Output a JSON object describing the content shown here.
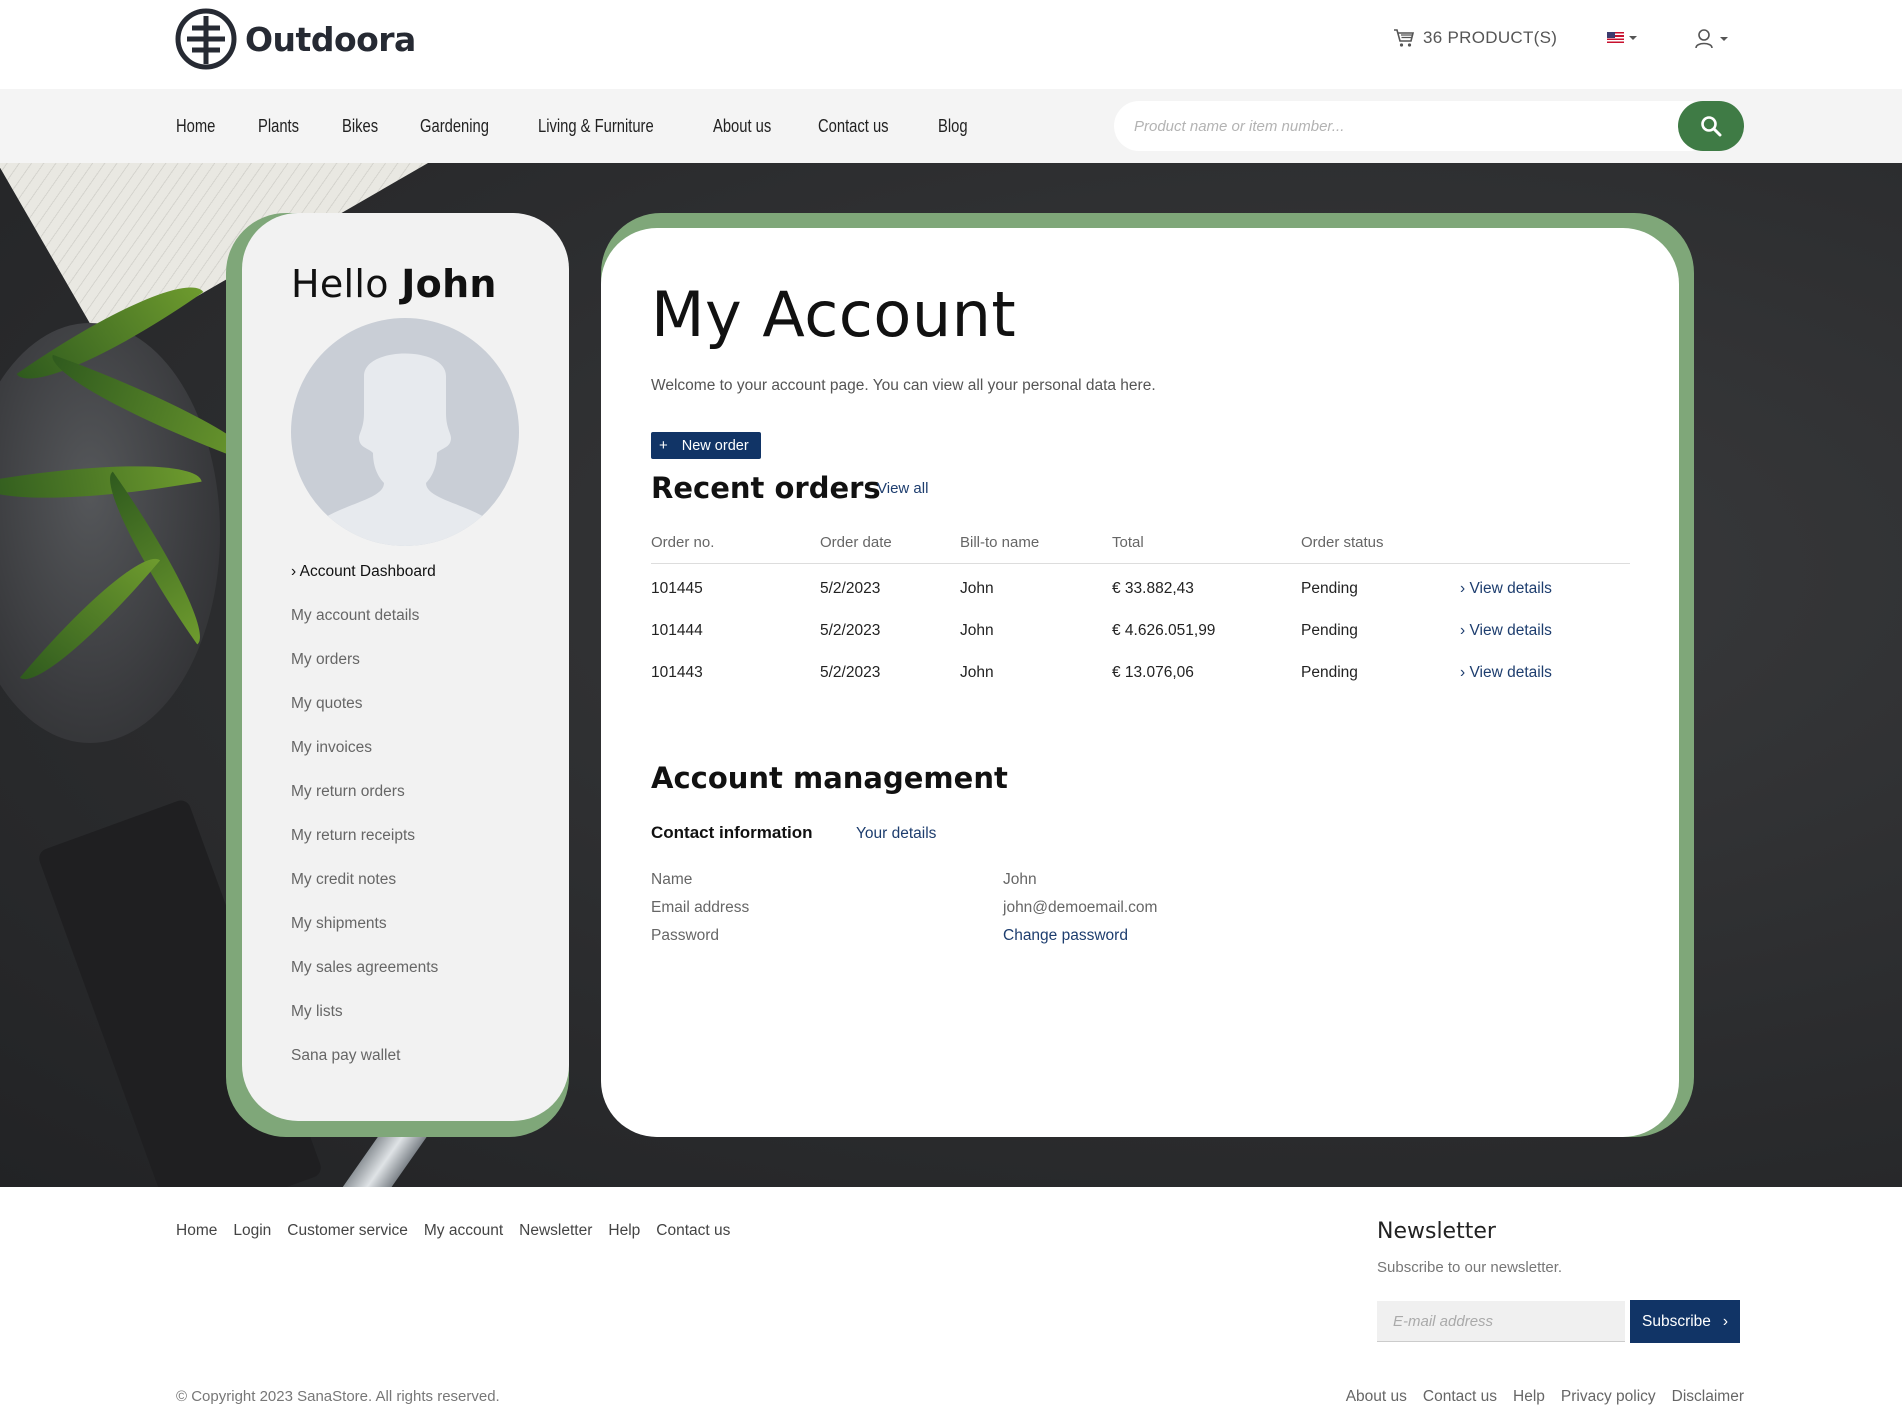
{
  "brand": {
    "name": "Outdoora"
  },
  "header": {
    "cart_label": "36 PRODUCT(S)",
    "cart_icon": "cart-icon",
    "language_icon": "us-flag-icon",
    "user_icon": "user-icon"
  },
  "nav": {
    "items": [
      {
        "label": "Home"
      },
      {
        "label": "Plants"
      },
      {
        "label": "Bikes"
      },
      {
        "label": "Gardening"
      },
      {
        "label": "Living & Furniture"
      },
      {
        "label": "About us"
      },
      {
        "label": "Contact us"
      },
      {
        "label": "Blog"
      }
    ],
    "search_placeholder": "Product name or item number..."
  },
  "sidebar": {
    "greeting": "Hello",
    "user_name": "John",
    "items": [
      {
        "label": "› Account Dashboard",
        "active": true
      },
      {
        "label": "My account details"
      },
      {
        "label": "My orders"
      },
      {
        "label": "My quotes"
      },
      {
        "label": "My invoices"
      },
      {
        "label": "My return orders"
      },
      {
        "label": "My return receipts"
      },
      {
        "label": "My credit notes"
      },
      {
        "label": "My shipments"
      },
      {
        "label": "My sales agreements"
      },
      {
        "label": "My lists"
      },
      {
        "label": "Sana pay wallet"
      }
    ]
  },
  "main": {
    "title": "My Account",
    "welcome": "Welcome to your account page. You can view all your personal data here.",
    "new_order_label": "New order",
    "recent_orders": {
      "title": "Recent orders",
      "view_all": "View all",
      "columns": [
        "Order no.",
        "Order date",
        "Bill-to name",
        "Total",
        "Order status"
      ],
      "rows": [
        {
          "order_no": "101445",
          "date": "5/2/2023",
          "bill_to": "John",
          "total": "€ 33.882,43",
          "status": "Pending",
          "action": "› View details"
        },
        {
          "order_no": "101444",
          "date": "5/2/2023",
          "bill_to": "John",
          "total": "€ 4.626.051,99",
          "status": "Pending",
          "action": "› View details"
        },
        {
          "order_no": "101443",
          "date": "5/2/2023",
          "bill_to": "John",
          "total": "€ 13.076,06",
          "status": "Pending",
          "action": "› View details"
        }
      ]
    },
    "account_management": {
      "title": "Account management",
      "contact_heading": "Contact information",
      "your_details": "Your details",
      "fields": [
        {
          "label": "Name",
          "value": "John"
        },
        {
          "label": "Email address",
          "value": "john@demoemail.com"
        },
        {
          "label": "Password",
          "value": "Change password"
        }
      ]
    }
  },
  "footer": {
    "links": [
      "Home",
      "Login",
      "Customer service",
      "My account",
      "Newsletter",
      "Help",
      "Contact us"
    ],
    "newsletter_title": "Newsletter",
    "newsletter_sub": "Subscribe to our newsletter.",
    "email_placeholder": "E-mail address",
    "subscribe_label": "Subscribe",
    "copyright": "© Copyright 2023 SanaStore. All rights reserved.",
    "legal_links": [
      "About us",
      "Contact us",
      "Help",
      "Privacy policy",
      "Disclaimer"
    ]
  },
  "colors": {
    "accent_green": "#3f7b45",
    "frame_green": "#7fa779",
    "navy": "#113466",
    "link": "#1d3d6e"
  }
}
